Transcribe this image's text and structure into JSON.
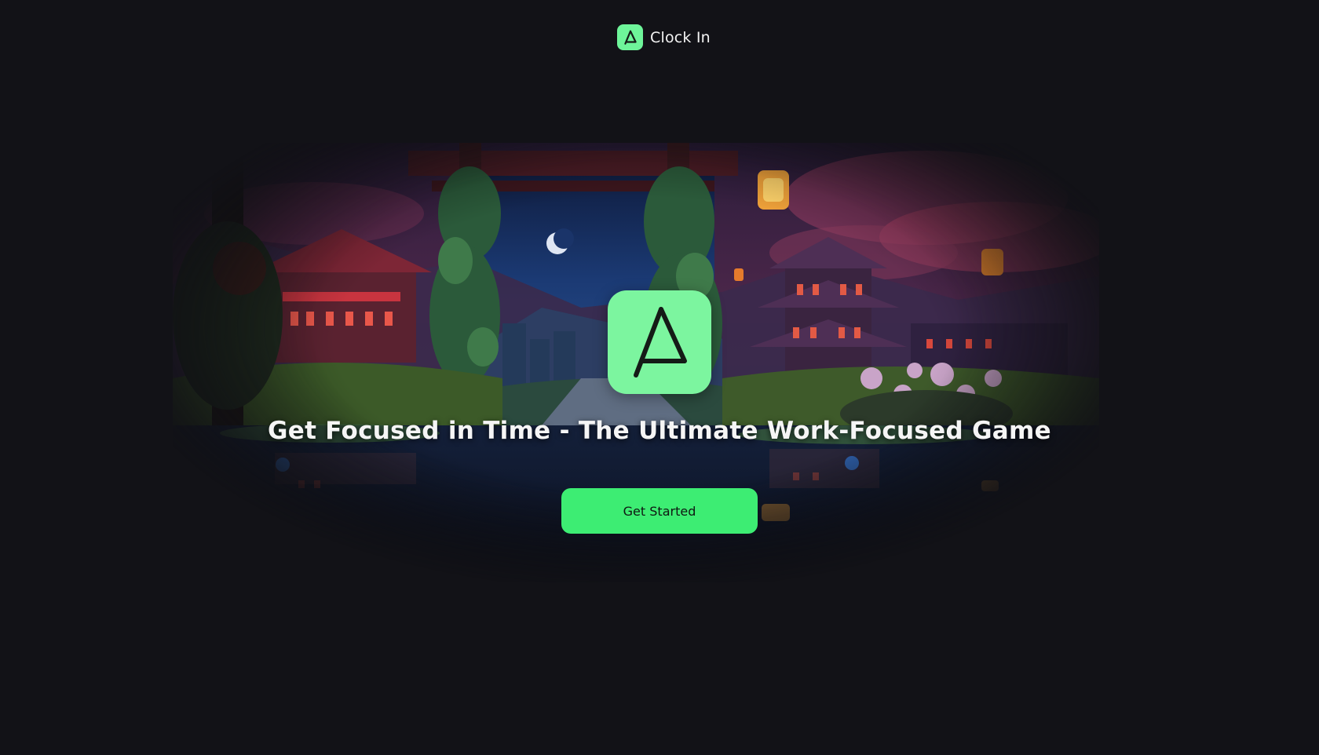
{
  "brand": {
    "name": "Clock In",
    "icon": "clock-in-logo-icon"
  },
  "hero": {
    "background": "pixel-art-japanese-night-scene",
    "logo_icon": "clock-in-logo-icon",
    "headline": "Get Focused in Time - The Ultimate Work-Focused Game",
    "cta_label": "Get Started"
  },
  "colors": {
    "page_background": "#121217",
    "accent_green": "#3ded73",
    "logo_green": "#7cf59f",
    "text": "#f5f5f5"
  }
}
